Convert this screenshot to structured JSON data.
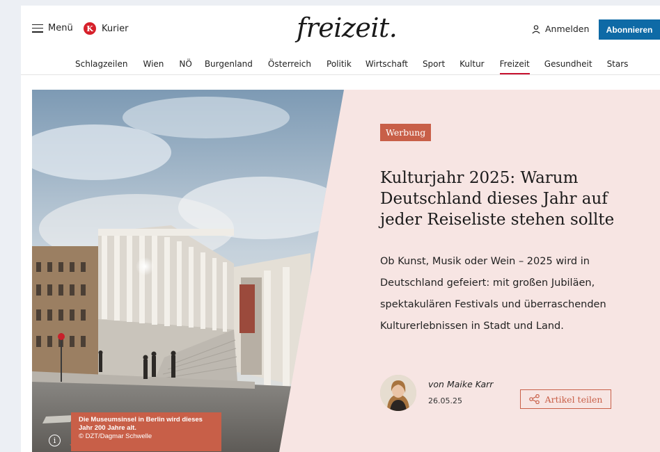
{
  "header": {
    "menu_label": "Menü",
    "kurier_badge": "K",
    "kurier_label": "Kurier",
    "logo": "freizeit.",
    "login_label": "Anmelden",
    "subscribe_label": "Abonnieren"
  },
  "nav": {
    "items": [
      "Schlagzeilen",
      "Wien",
      "NÖ",
      "Burgenland",
      "Österreich",
      "Politik",
      "Wirtschaft",
      "Sport",
      "Kultur",
      "Freizeit",
      "Gesundheit",
      "Stars"
    ],
    "active": "Freizeit"
  },
  "article": {
    "badge": "Werbung",
    "headline": "Kulturjahr 2025: Warum Deutschland dieses Jahr auf jeder Reiseliste stehen sollte",
    "teaser": "Ob Kunst, Musik oder Wein – 2025 wird in Deutschland gefeiert: mit großen Jubiläen, spektakulären Festivals und überraschenden Kulturerlebnissen in Stadt und Land.",
    "author": "von Maike Karr",
    "date": "26.05.25",
    "share_label": "Artikel teilen"
  },
  "image": {
    "caption_line1": "Die Museumsinsel in Berlin wird dieses",
    "caption_line2": "Jahr 200 Jahre alt.",
    "credit": "© DZT/Dagmar Schwelle",
    "info_icon": "i"
  },
  "colors": {
    "accent": "#c85f48",
    "subscribe": "#0e6aa6",
    "hero_bg": "#f7e5e3",
    "nav_active": "#c8102e"
  }
}
